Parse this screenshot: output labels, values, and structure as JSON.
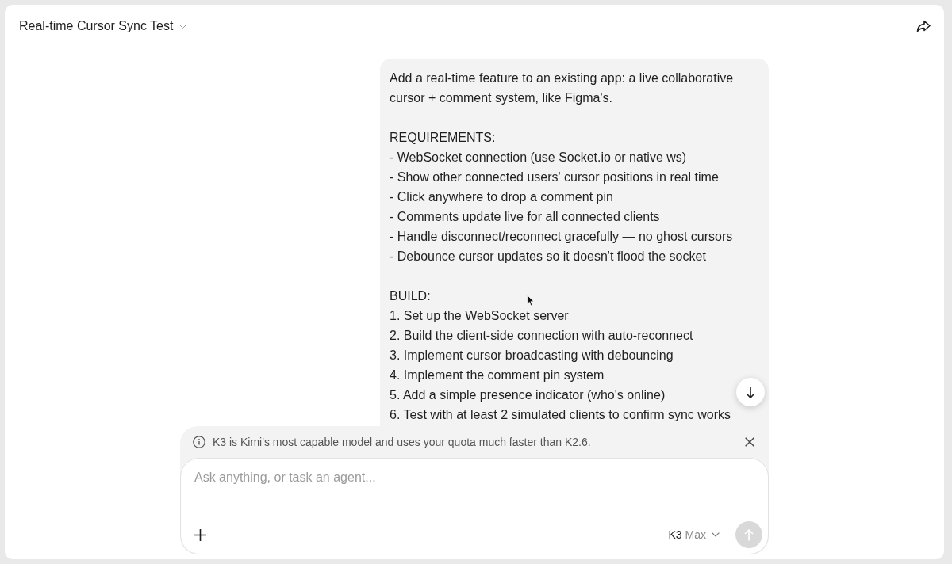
{
  "header": {
    "title": "Real-time Cursor Sync Test"
  },
  "message": {
    "blocks": [
      {
        "kind": "paragraph",
        "text": "Add a real-time feature to an existing app: a live collaborative cursor + comment system, like Figma's."
      },
      {
        "kind": "list",
        "heading": "REQUIREMENTS:",
        "items": [
          "- WebSocket connection (use Socket.io or native ws)",
          "- Show other connected users' cursor positions in real time",
          "- Click anywhere to drop a comment pin",
          "- Comments update live for all connected clients",
          "- Handle disconnect/reconnect gracefully — no ghost cursors",
          "- Debounce cursor updates so it doesn't flood the socket"
        ]
      },
      {
        "kind": "list",
        "heading": "BUILD:",
        "items": [
          "1. Set up the WebSocket server",
          "2. Build the client-side connection with auto-reconnect",
          "3. Implement cursor broadcasting with debouncing",
          "4. Implement the comment pin system",
          "5. Add a simple presence indicator (who's online)",
          "6. Test with at least 2 simulated clients to confirm sync works"
        ]
      }
    ]
  },
  "notice": {
    "text": "K3 is Kimi's most capable model and uses your quota much faster than K2.6."
  },
  "composer": {
    "placeholder": "Ask anything, or task an agent...",
    "model": "K3",
    "mode": "Max",
    "send_disabled": true
  }
}
